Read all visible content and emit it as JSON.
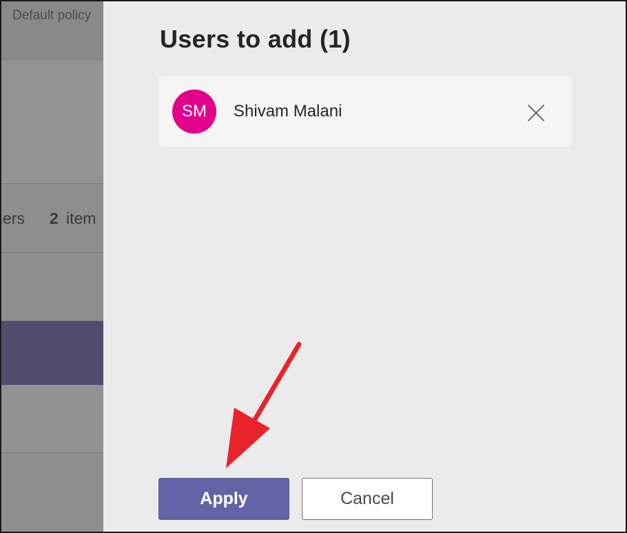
{
  "background_page": {
    "subtitle": "Default policy",
    "partial_label": "ers",
    "items_count": "2",
    "items_label": "item"
  },
  "panel": {
    "title": "Users to add (1)",
    "users": [
      {
        "initials": "SM",
        "name": "Shivam Malani",
        "avatar_color": "#e3008c",
        "remove_icon": "close-icon"
      }
    ]
  },
  "footer": {
    "apply_label": "Apply",
    "cancel_label": "Cancel"
  },
  "colors": {
    "accent": "#6264a7",
    "annotation": "#e8232a"
  }
}
